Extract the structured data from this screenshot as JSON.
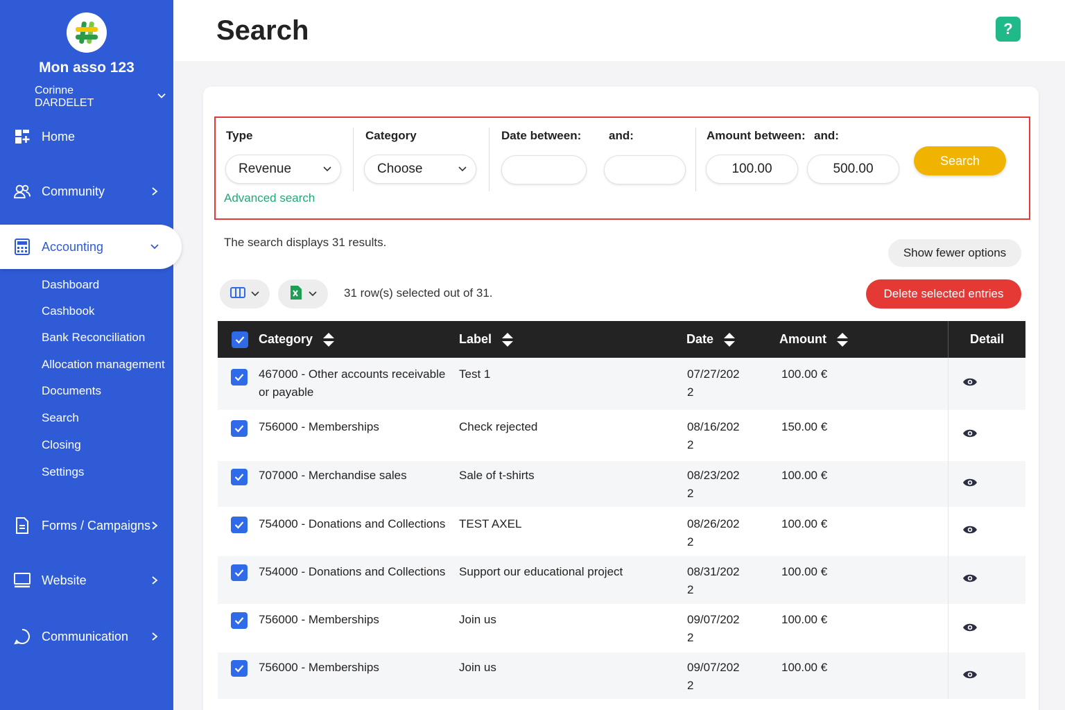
{
  "sidebar": {
    "org_name": "Mon asso 123",
    "user_name": "Corinne DARDELET",
    "nav": {
      "home": "Home",
      "community": "Community",
      "accounting": "Accounting",
      "forms": "Forms / Campaigns",
      "website": "Website",
      "communication": "Communication"
    },
    "accounting_sub": [
      "Dashboard",
      "Cashbook",
      "Bank Reconciliation",
      "Allocation management",
      "Documents",
      "Search",
      "Closing",
      "Settings"
    ]
  },
  "header": {
    "title": "Search",
    "help": "?"
  },
  "filters": {
    "type_label": "Type",
    "type_value": "Revenue",
    "category_label": "Category",
    "category_value": "Choose",
    "date_between_label": "Date between:",
    "date_and_label": "and:",
    "date_from": "",
    "date_to": "",
    "amount_between_label": "Amount between:",
    "amount_and_label": "and:",
    "amount_min": "100.00",
    "amount_max": "500.00",
    "advanced_link": "Advanced search",
    "search_button": "Search"
  },
  "results": {
    "summary": "The search displays 31 results.",
    "fewer_options": "Show fewer options",
    "selected_text": "31 row(s) selected out of 31.",
    "delete_button": "Delete selected entries"
  },
  "table": {
    "columns": {
      "category": "Category",
      "label": "Label",
      "date": "Date",
      "amount": "Amount",
      "detail": "Detail"
    },
    "rows": [
      {
        "category": "467000 - Other accounts receivable or payable",
        "label": "Test 1",
        "date": "07/27/2022",
        "amount": "100.00 €",
        "checked": true
      },
      {
        "category": "756000 - Memberships",
        "label": "Check rejected",
        "date": "08/16/2022",
        "amount": "150.00 €",
        "checked": true
      },
      {
        "category": "707000 - Merchandise sales",
        "label": "Sale of t-shirts",
        "date": "08/23/2022",
        "amount": "100.00 €",
        "checked": true
      },
      {
        "category": "754000 - Donations and Collections",
        "label": "TEST AXEL",
        "date": "08/26/2022",
        "amount": "100.00 €",
        "checked": true
      },
      {
        "category": "754000 - Donations and Collections",
        "label": "Support our educational project",
        "date": "08/31/2022",
        "amount": "100.00 €",
        "checked": true
      },
      {
        "category": "756000 - Memberships",
        "label": "Join us",
        "date": "09/07/2022",
        "amount": "100.00 €",
        "checked": true
      },
      {
        "category": "756000 - Memberships",
        "label": "Join us",
        "date": "09/07/2022",
        "amount": "100.00 €",
        "checked": true
      }
    ]
  },
  "colors": {
    "sidebar": "#2f5bd6",
    "accent_green": "#1fb98a",
    "search_yellow": "#f0b400",
    "delete_red": "#e53935",
    "checkbox_blue": "#2f6ae8"
  }
}
